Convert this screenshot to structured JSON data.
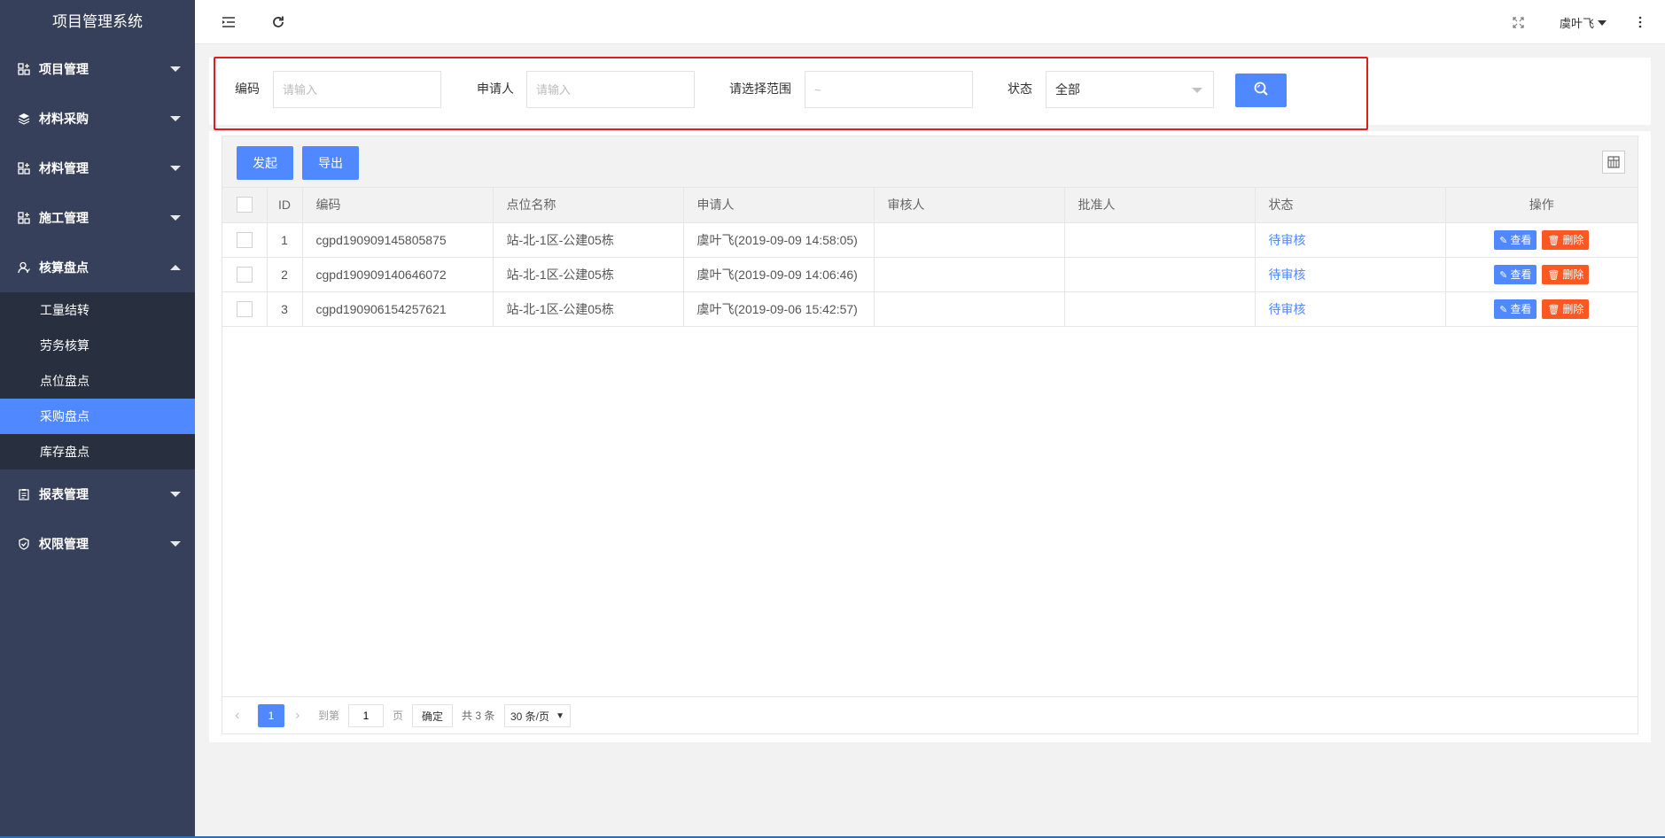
{
  "app": {
    "title": "项目管理系统"
  },
  "sidebar": {
    "items": [
      {
        "label": "项目管理"
      },
      {
        "label": "材料采购"
      },
      {
        "label": "材料管理"
      },
      {
        "label": "施工管理"
      },
      {
        "label": "核算盘点",
        "expanded": true,
        "children": [
          {
            "label": "工量结转"
          },
          {
            "label": "劳务核算"
          },
          {
            "label": "点位盘点"
          },
          {
            "label": "采购盘点",
            "active": true
          },
          {
            "label": "库存盘点"
          }
        ]
      },
      {
        "label": "报表管理"
      },
      {
        "label": "权限管理"
      }
    ]
  },
  "header": {
    "user": "虞叶飞"
  },
  "search": {
    "code_label": "编码",
    "code_placeholder": "请输入",
    "applicant_label": "申请人",
    "applicant_placeholder": "请输入",
    "range_label": "请选择范围",
    "range_placeholder": "~",
    "status_label": "状态",
    "status_value": "全部"
  },
  "toolbar": {
    "start_label": "发起",
    "export_label": "导出"
  },
  "table": {
    "columns": [
      "ID",
      "编码",
      "点位名称",
      "申请人",
      "审核人",
      "批准人",
      "状态",
      "操作"
    ],
    "rows": [
      {
        "id": "1",
        "code": "cgpd190909145805875",
        "site": "站-北-1区-公建05栋",
        "applicant": "虞叶飞(2019-09-09 14:58:05)",
        "reviewer": "",
        "approver": "",
        "status": "待审核"
      },
      {
        "id": "2",
        "code": "cgpd190909140646072",
        "site": "站-北-1区-公建05栋",
        "applicant": "虞叶飞(2019-09-09 14:06:46)",
        "reviewer": "",
        "approver": "",
        "status": "待审核"
      },
      {
        "id": "3",
        "code": "cgpd190906154257621",
        "site": "站-北-1区-公建05栋",
        "applicant": "虞叶飞(2019-09-06 15:42:57)",
        "reviewer": "",
        "approver": "",
        "status": "待审核"
      }
    ],
    "view_label": "查看",
    "delete_label": "删除"
  },
  "pager": {
    "current": "1",
    "goto_label": "到第",
    "goto_value": "1",
    "page_unit": "页",
    "confirm_label": "确定",
    "total_text": "共 3 条",
    "page_size": "30 条/页"
  },
  "colors": {
    "primary": "#5089ff",
    "danger": "#ff5722",
    "sidebar": "#37405a",
    "highlight": "#e21b1b"
  }
}
